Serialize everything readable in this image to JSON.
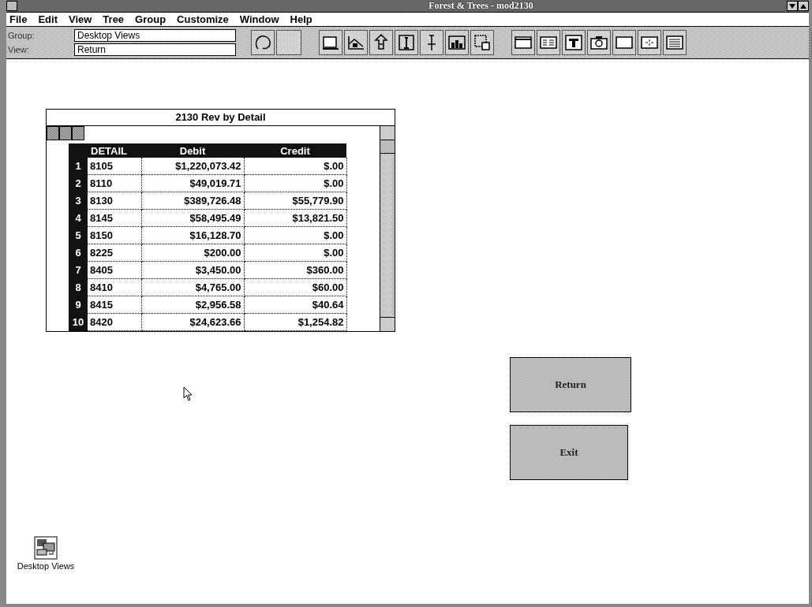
{
  "window": {
    "title": "Forest & Trees - mod2130"
  },
  "menu": [
    "File",
    "Edit",
    "View",
    "Tree",
    "Group",
    "Customize",
    "Window",
    "Help"
  ],
  "fields": [
    {
      "label": "Group:",
      "value": "Desktop Views"
    },
    {
      "label": "View:",
      "value": "Return"
    }
  ],
  "table_window": {
    "title": "2130 Rev by Detail",
    "columns": [
      "DETAIL",
      "Debit",
      "Credit"
    ],
    "rows": [
      {
        "number": "1",
        "cells": [
          "8105",
          "$1,220,073.42",
          "$.00"
        ]
      },
      {
        "number": "2",
        "cells": [
          "8110",
          "$49,019.71",
          "$.00"
        ]
      },
      {
        "number": "3",
        "cells": [
          "8130",
          "$389,726.48",
          "$55,779.90"
        ]
      },
      {
        "number": "4",
        "cells": [
          "8145",
          "$58,495.49",
          "$13,821.50"
        ]
      },
      {
        "number": "5",
        "cells": [
          "8150",
          "$16,128.70",
          "$.00"
        ]
      },
      {
        "number": "6",
        "cells": [
          "8225",
          "$200.00",
          "$.00"
        ]
      },
      {
        "number": "7",
        "cells": [
          "8405",
          "$3,450.00",
          "$360.00"
        ]
      },
      {
        "number": "8",
        "cells": [
          "8410",
          "$4,765.00",
          "$60.00"
        ]
      },
      {
        "number": "9",
        "cells": [
          "8415",
          "$2,956.58",
          "$40.64"
        ]
      },
      {
        "number": "10",
        "cells": [
          "8420",
          "$24,623.66",
          "$1,254.82"
        ]
      }
    ]
  },
  "buttons": [
    "Return",
    "Exit"
  ],
  "desktop_icon": {
    "label": "Desktop Views"
  }
}
